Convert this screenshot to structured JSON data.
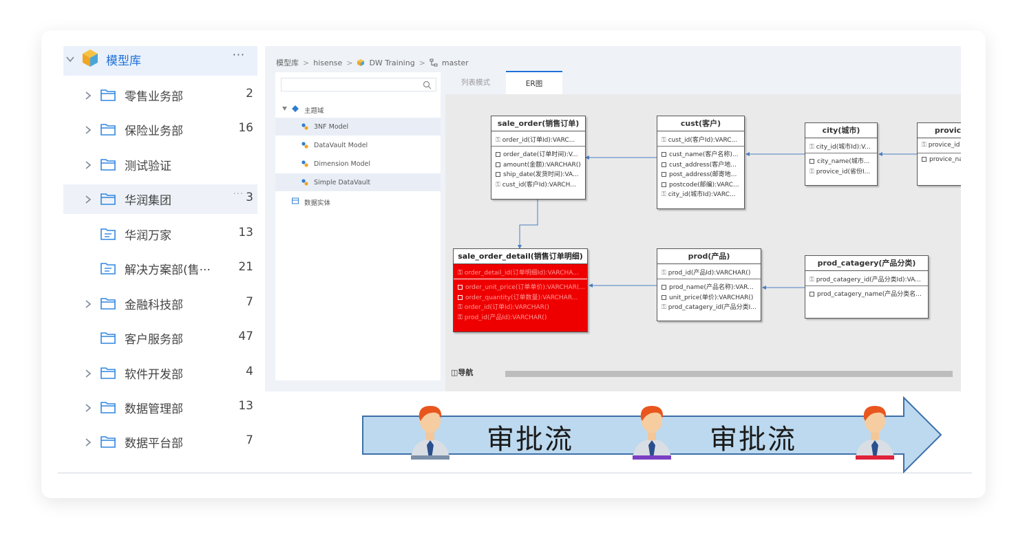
{
  "left_tree": {
    "root_label": "模型库",
    "root_more": "···",
    "items": [
      {
        "label": "零售业务部",
        "count": "2",
        "expandable": true,
        "icon": "folder-icon"
      },
      {
        "label": "保险业务部",
        "count": "16",
        "expandable": true,
        "icon": "folder-icon"
      },
      {
        "label": "测试验证",
        "count": "",
        "expandable": true,
        "icon": "folder-icon"
      },
      {
        "label": "华润集团",
        "count": "3",
        "expandable": true,
        "icon": "folder-icon",
        "selected": true
      },
      {
        "label": "华润万家",
        "count": "13",
        "expandable": false,
        "icon": "shared-folder-icon"
      },
      {
        "label": "解决方案部(售···",
        "count": "21",
        "expandable": false,
        "icon": "shared-folder-icon"
      },
      {
        "label": "金融科技部",
        "count": "7",
        "expandable": true,
        "icon": "folder-icon"
      },
      {
        "label": "客户服务部",
        "count": "47",
        "expandable": false,
        "icon": "folder-icon"
      },
      {
        "label": "软件开发部",
        "count": "4",
        "expandable": true,
        "icon": "folder-icon"
      },
      {
        "label": "数据管理部",
        "count": "13",
        "expandable": true,
        "icon": "folder-icon"
      },
      {
        "label": "数据平台部",
        "count": "7",
        "expandable": true,
        "icon": "folder-icon"
      }
    ]
  },
  "breadcrumb": {
    "items": [
      "模型库",
      "hisense",
      "DW Training",
      "master"
    ]
  },
  "model_tree": {
    "root": "主题域",
    "models": [
      "3NF Model",
      "DataVault Model",
      "Dimension Model",
      "Simple DataVault"
    ],
    "entity_node": "数据实体"
  },
  "tabs": [
    "列表模式",
    "ER图"
  ],
  "er_tables": {
    "sale_order": {
      "title": "sale_order(销售订单)",
      "pk": "order_id(订单Id):VARC...",
      "fields": [
        "order_date(订单时间):V...",
        "amount(金额):VARCHAR()",
        "ship_date(发货时间):VA...",
        "cust_id(客户Id):VARCH..."
      ]
    },
    "cust": {
      "title": "cust(客户)",
      "pk": "cust_id(客户Id):VARC...",
      "fields": [
        "cust_name(客户名称)...",
        "cust_address(客户地...",
        "post_address(邮寄地...",
        "postcode(邮编):VARC...",
        "city_id(城市Id):VARC..."
      ]
    },
    "city": {
      "title": "city(城市)",
      "pk": "city_id(城市Id):V...",
      "fields": [
        "city_name(城市...",
        "provice_id(省份I..."
      ]
    },
    "provice": {
      "title": "provic",
      "pk": "provice_id",
      "fields": [
        "provice_na"
      ]
    },
    "sale_order_detail": {
      "title": "sale_order_detail(销售订单明细)",
      "pk": "order_detail_id(订单明细Id):VARCHA...",
      "fields": [
        "order_unit_price(订单单价):VARCHAR(...",
        "order_quantity(订单数量):VARCHAR...",
        "order_id(订单Id):VARCHAR()",
        "prod_id(产品Id):VARCHAR()"
      ]
    },
    "prod": {
      "title": "prod(产品)",
      "pk": "prod_id(产品Id):VARCHAR()",
      "fields": [
        "prod_name(产品名称):VAR...",
        "unit_price(单价):VARCHAR()",
        "prod_catagery_id(产品分类I..."
      ]
    },
    "prod_catagery": {
      "title": "prod_catagery(产品分类)",
      "pk": "prod_catagery_id(产品分类Id):VA...",
      "fields": [
        "prod_catagery_name(产品分类名..."
      ]
    }
  },
  "nav_label": "导航",
  "approval_flow": {
    "steps": [
      "审批流",
      "审批流"
    ],
    "person_accent_colors": [
      "#7a8fa8",
      "#7b3fc4",
      "#e0223a"
    ],
    "arrow_color": "#bcd9ef"
  }
}
